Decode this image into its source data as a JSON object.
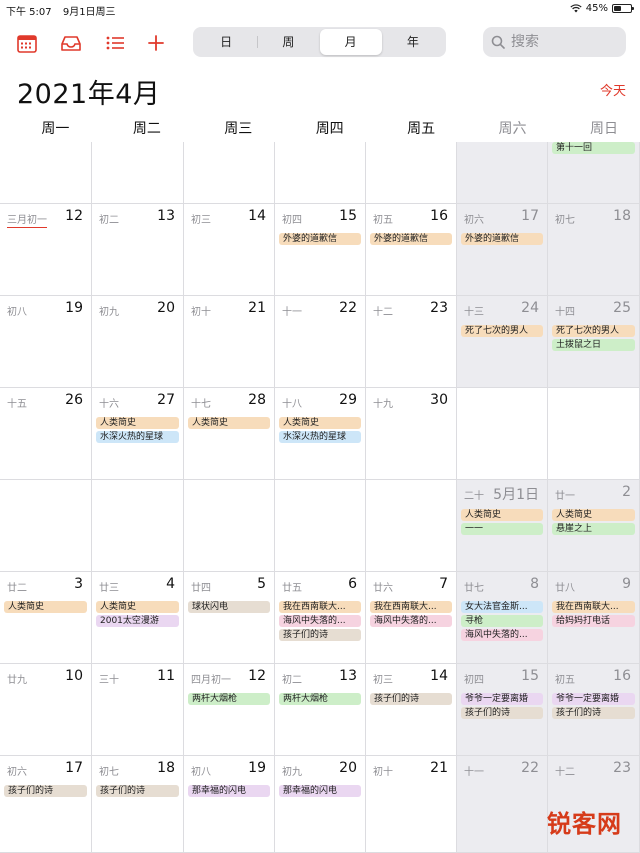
{
  "status": {
    "time": "下午 5:07",
    "date": "9月1日周三",
    "battery": "45%",
    "battery_level": 0.45
  },
  "toolbar": {
    "views": [
      {
        "label": "日"
      },
      {
        "label": "周"
      },
      {
        "label": "月"
      },
      {
        "label": "年"
      }
    ],
    "active_view": "月",
    "search_placeholder": "搜索"
  },
  "header": {
    "title": "2021年4月",
    "today_label": "今天"
  },
  "weekdays": [
    "周一",
    "周二",
    "周三",
    "周四",
    "周五",
    "周六",
    "周日"
  ],
  "weeks": [
    {
      "days": [
        {
          "lunar": "",
          "num": "",
          "events": []
        },
        {
          "lunar": "",
          "num": "",
          "events": []
        },
        {
          "lunar": "",
          "num": "",
          "events": []
        },
        {
          "lunar": "",
          "num": "",
          "events": []
        },
        {
          "lunar": "",
          "num": "",
          "events": []
        },
        {
          "lunar": "",
          "num": "",
          "events": []
        },
        {
          "lunar": "",
          "num": "",
          "events": [
            {
              "title": "第十一回",
              "color": "green"
            }
          ]
        }
      ]
    },
    {
      "days": [
        {
          "lunar": "三月初一",
          "num": "12",
          "events": []
        },
        {
          "lunar": "初二",
          "num": "13",
          "events": []
        },
        {
          "lunar": "初三",
          "num": "14",
          "events": []
        },
        {
          "lunar": "初四",
          "num": "15",
          "events": [
            {
              "title": "外婆的道歉信",
              "color": "orange"
            }
          ]
        },
        {
          "lunar": "初五",
          "num": "16",
          "events": [
            {
              "title": "外婆的道歉信",
              "color": "orange"
            }
          ]
        },
        {
          "lunar": "初六",
          "num": "17",
          "events": [
            {
              "title": "外婆的道歉信",
              "color": "orange"
            }
          ]
        },
        {
          "lunar": "初七",
          "num": "18",
          "events": []
        }
      ]
    },
    {
      "days": [
        {
          "lunar": "初八",
          "num": "19",
          "events": []
        },
        {
          "lunar": "初九",
          "num": "20",
          "events": []
        },
        {
          "lunar": "初十",
          "num": "21",
          "events": []
        },
        {
          "lunar": "十一",
          "num": "22",
          "events": []
        },
        {
          "lunar": "十二",
          "num": "23",
          "events": []
        },
        {
          "lunar": "十三",
          "num": "24",
          "events": [
            {
              "title": "死了七次的男人",
              "color": "orange"
            }
          ]
        },
        {
          "lunar": "十四",
          "num": "25",
          "events": [
            {
              "title": "死了七次的男人",
              "color": "orange"
            },
            {
              "title": "土拨鼠之日",
              "color": "green"
            }
          ]
        }
      ]
    },
    {
      "days": [
        {
          "lunar": "十五",
          "num": "26",
          "events": []
        },
        {
          "lunar": "十六",
          "num": "27",
          "events": [
            {
              "title": "人类简史",
              "color": "orange"
            },
            {
              "title": "水深火热的星球",
              "color": "blue"
            }
          ]
        },
        {
          "lunar": "十七",
          "num": "28",
          "events": [
            {
              "title": "人类简史",
              "color": "orange"
            }
          ]
        },
        {
          "lunar": "十八",
          "num": "29",
          "events": [
            {
              "title": "人类简史",
              "color": "orange"
            },
            {
              "title": "水深火热的星球",
              "color": "blue"
            }
          ]
        },
        {
          "lunar": "十九",
          "num": "30",
          "events": []
        },
        {
          "lunar": "",
          "num": "",
          "events": []
        },
        {
          "lunar": "",
          "num": "",
          "events": []
        }
      ]
    },
    {
      "days": [
        {
          "lunar": "",
          "num": "",
          "events": []
        },
        {
          "lunar": "",
          "num": "",
          "events": []
        },
        {
          "lunar": "",
          "num": "",
          "events": []
        },
        {
          "lunar": "",
          "num": "",
          "events": []
        },
        {
          "lunar": "",
          "num": "",
          "events": []
        },
        {
          "lunar": "二十",
          "num": "5月1日",
          "events": [
            {
              "title": "人类简史",
              "color": "orange"
            },
            {
              "title": "一一",
              "color": "green"
            }
          ]
        },
        {
          "lunar": "廿一",
          "num": "2",
          "events": [
            {
              "title": "人类简史",
              "color": "orange"
            },
            {
              "title": "悬崖之上",
              "color": "green"
            }
          ]
        }
      ]
    },
    {
      "days": [
        {
          "lunar": "廿二",
          "num": "3",
          "events": [
            {
              "title": "人类简史",
              "color": "orange"
            }
          ]
        },
        {
          "lunar": "廿三",
          "num": "4",
          "events": [
            {
              "title": "人类简史",
              "color": "orange"
            },
            {
              "title": "2001太空漫游",
              "color": "purple"
            }
          ]
        },
        {
          "lunar": "廿四",
          "num": "5",
          "events": [
            {
              "title": "球状闪电",
              "color": "tan"
            }
          ]
        },
        {
          "lunar": "廿五",
          "num": "6",
          "events": [
            {
              "title": "我在西南联大...",
              "color": "orange"
            },
            {
              "title": "海风中失落的...",
              "color": "pink"
            },
            {
              "title": "孩子们的诗",
              "color": "tan"
            }
          ]
        },
        {
          "lunar": "廿六",
          "num": "7",
          "events": [
            {
              "title": "我在西南联大...",
              "color": "orange"
            },
            {
              "title": "海风中失落的...",
              "color": "pink"
            }
          ]
        },
        {
          "lunar": "廿七",
          "num": "8",
          "events": [
            {
              "title": "女大法官金斯...",
              "color": "blue"
            },
            {
              "title": "寻枪",
              "color": "green"
            },
            {
              "title": "海风中失落的...",
              "color": "pink"
            }
          ]
        },
        {
          "lunar": "廿八",
          "num": "9",
          "events": [
            {
              "title": "我在西南联大...",
              "color": "orange"
            },
            {
              "title": "给妈妈打电话",
              "color": "pink"
            }
          ]
        }
      ]
    },
    {
      "days": [
        {
          "lunar": "廿九",
          "num": "10",
          "events": []
        },
        {
          "lunar": "三十",
          "num": "11",
          "events": []
        },
        {
          "lunar": "四月初一",
          "num": "12",
          "events": [
            {
              "title": "两杆大烟枪",
              "color": "green"
            }
          ]
        },
        {
          "lunar": "初二",
          "num": "13",
          "events": [
            {
              "title": "两杆大烟枪",
              "color": "green"
            }
          ]
        },
        {
          "lunar": "初三",
          "num": "14",
          "events": [
            {
              "title": "孩子们的诗",
              "color": "tan"
            }
          ]
        },
        {
          "lunar": "初四",
          "num": "15",
          "events": [
            {
              "title": "爷爷一定要离婚",
              "color": "purple"
            },
            {
              "title": "孩子们的诗",
              "color": "tan"
            }
          ]
        },
        {
          "lunar": "初五",
          "num": "16",
          "events": [
            {
              "title": "爷爷一定要离婚",
              "color": "purple"
            },
            {
              "title": "孩子们的诗",
              "color": "tan"
            }
          ]
        }
      ]
    },
    {
      "days": [
        {
          "lunar": "初六",
          "num": "17",
          "events": [
            {
              "title": "孩子们的诗",
              "color": "tan"
            }
          ]
        },
        {
          "lunar": "初七",
          "num": "18",
          "events": [
            {
              "title": "孩子们的诗",
              "color": "tan"
            }
          ]
        },
        {
          "lunar": "初八",
          "num": "19",
          "events": [
            {
              "title": "那幸福的闪电",
              "color": "purple"
            }
          ]
        },
        {
          "lunar": "初九",
          "num": "20",
          "events": [
            {
              "title": "那幸福的闪电",
              "color": "purple"
            }
          ]
        },
        {
          "lunar": "初十",
          "num": "21",
          "events": []
        },
        {
          "lunar": "十一",
          "num": "22",
          "events": []
        },
        {
          "lunar": "十二",
          "num": "23",
          "events": []
        }
      ]
    }
  ],
  "watermark": "锐客网"
}
